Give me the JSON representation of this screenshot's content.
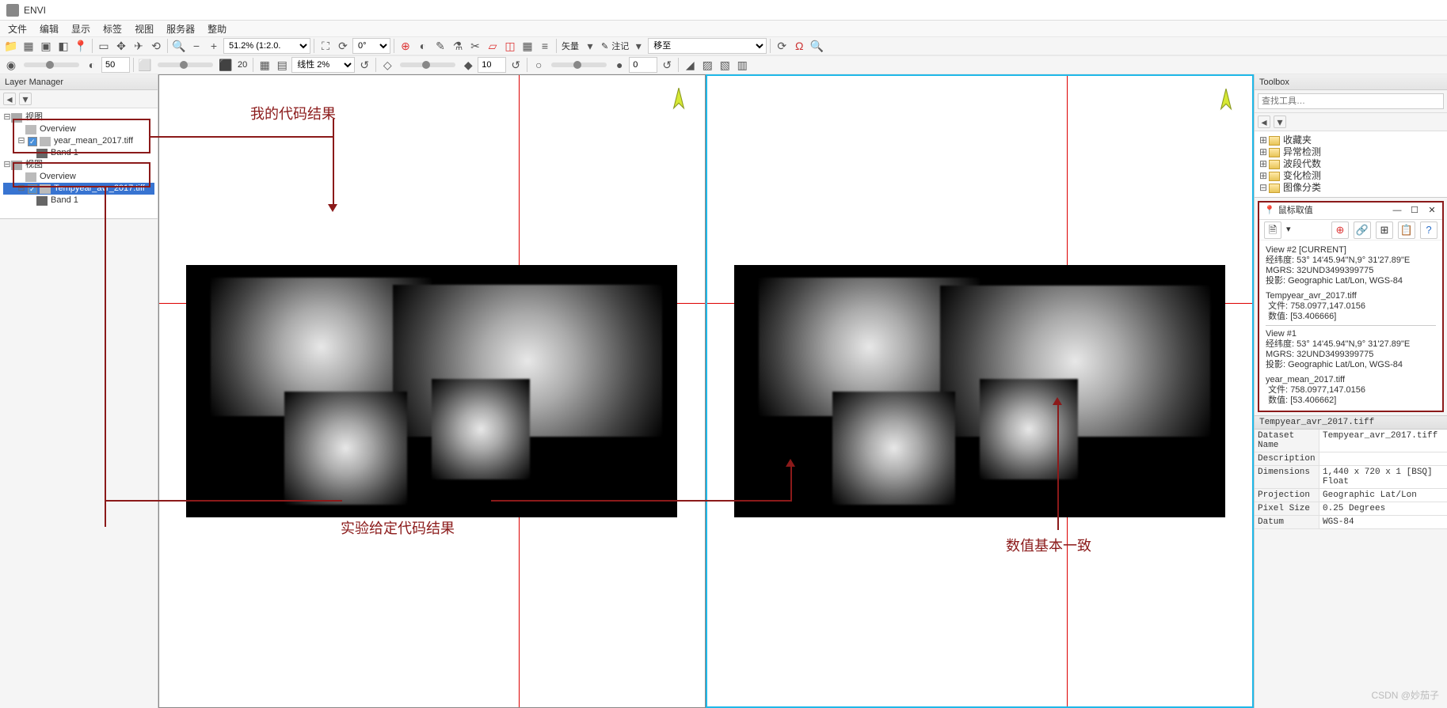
{
  "app": {
    "title": "ENVI"
  },
  "menu": [
    "文件",
    "编辑",
    "显示",
    "标签",
    "视图",
    "服务器",
    "整助"
  ],
  "toolbar1": {
    "zoom": "51.2% (1:2.0.",
    "rotate": "0°",
    "text_tool": "矢量",
    "annotate": "注记",
    "goto": "移至"
  },
  "toolbar2": {
    "val1": "50",
    "stretch": "线性 2%",
    "val2": "10",
    "val3": "0"
  },
  "layer_panel": {
    "title": "Layer Manager",
    "views": [
      {
        "label": "视图",
        "overview": "Overview",
        "file": "year_mean_2017.tiff",
        "band": "Band 1",
        "selected": false
      },
      {
        "label": "视图",
        "overview": "Overview",
        "file": "Tempyear_avr_2017.tiff",
        "band": "Band 1",
        "selected": true
      }
    ]
  },
  "toolbox": {
    "title": "Toolbox",
    "search_ph": "查找工具…",
    "items": [
      "收藏夹",
      "异常检测",
      "波段代数",
      "变化检测",
      "图像分类"
    ]
  },
  "cursor": {
    "title": "鼠标取值",
    "view2": {
      "header": "View #2 [CURRENT]",
      "latlon_k": "经纬度:",
      "latlon_v": "53° 14'45.94\"N,9° 31'27.89\"E",
      "mgrs_k": "MGRS:",
      "mgrs_v": "32UND3499399775",
      "proj_k": "投影:",
      "proj_v": "Geographic Lat/Lon, WGS-84",
      "file": "Tempyear_avr_2017.tiff",
      "fxy_k": "文件:",
      "fxy_v": "758.0977,147.0156",
      "val_k": "数值:",
      "val_v": "[53.406666]"
    },
    "view1": {
      "header": "View #1",
      "latlon_k": "经纬度:",
      "latlon_v": "53° 14'45.94\"N,9° 31'27.89\"E",
      "mgrs_k": "MGRS:",
      "mgrs_v": "32UND3499399775",
      "proj_k": "投影:",
      "proj_v": "Geographic Lat/Lon, WGS-84",
      "file": "year_mean_2017.tiff",
      "fxy_k": "文件:",
      "fxy_v": "758.0977,147.0156",
      "val_k": "数值:",
      "val_v": "[53.406662]"
    }
  },
  "meta": {
    "title": "Tempyear_avr_2017.tiff",
    "rows": [
      {
        "k": "Dataset Name",
        "v": "Tempyear_avr_2017.tiff"
      },
      {
        "k": "Description",
        "v": ""
      },
      {
        "k": "Dimensions",
        "v": "1,440 x 720 x 1 [BSQ] Float"
      },
      {
        "k": "Projection",
        "v": "Geographic Lat/Lon"
      },
      {
        "k": "Pixel Size",
        "v": "0.25 Degrees"
      },
      {
        "k": "Datum",
        "v": "WGS-84"
      }
    ]
  },
  "annotations": {
    "a1": "我的代码结果",
    "a2": "实验给定代码结果",
    "a3": "数值基本一致"
  },
  "watermark": "CSDN @妙茄子"
}
